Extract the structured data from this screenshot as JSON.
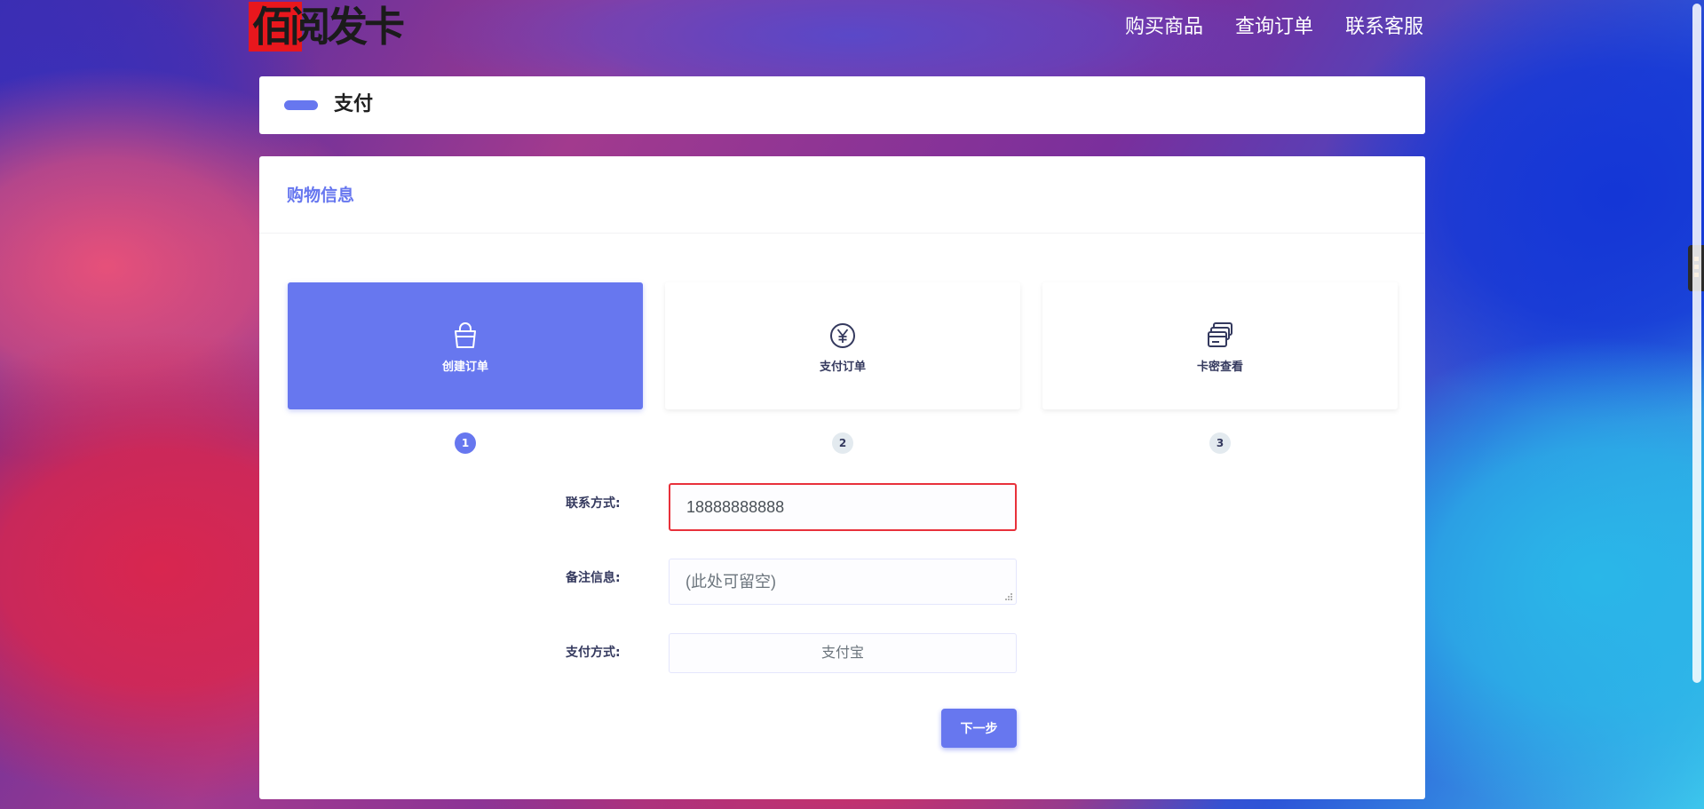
{
  "header": {
    "logo_text": "佰阅发卡",
    "nav": [
      "购买商品",
      "查询订单",
      "联系客服"
    ]
  },
  "page_title": "支付",
  "card": {
    "header": "购物信息",
    "steps": [
      {
        "label": "创建订单",
        "number": "1",
        "icon": "shopping-bag-icon",
        "active": true
      },
      {
        "label": "支付订单",
        "number": "2",
        "icon": "yen-coin-icon",
        "active": false
      },
      {
        "label": "卡密查看",
        "number": "3",
        "icon": "card-stack-icon",
        "active": false
      }
    ],
    "form": {
      "contact_label": "联系方式:",
      "contact_value": "18888888888",
      "remark_label": "备注信息:",
      "remark_placeholder": "(此处可留空)",
      "payment_label": "支付方式:",
      "payment_value": "支付宝",
      "next_button": "下一步"
    }
  },
  "colors": {
    "accent": "#6777ef",
    "error_border": "#e8313b",
    "step_inactive_badge": "#e3eaef"
  }
}
